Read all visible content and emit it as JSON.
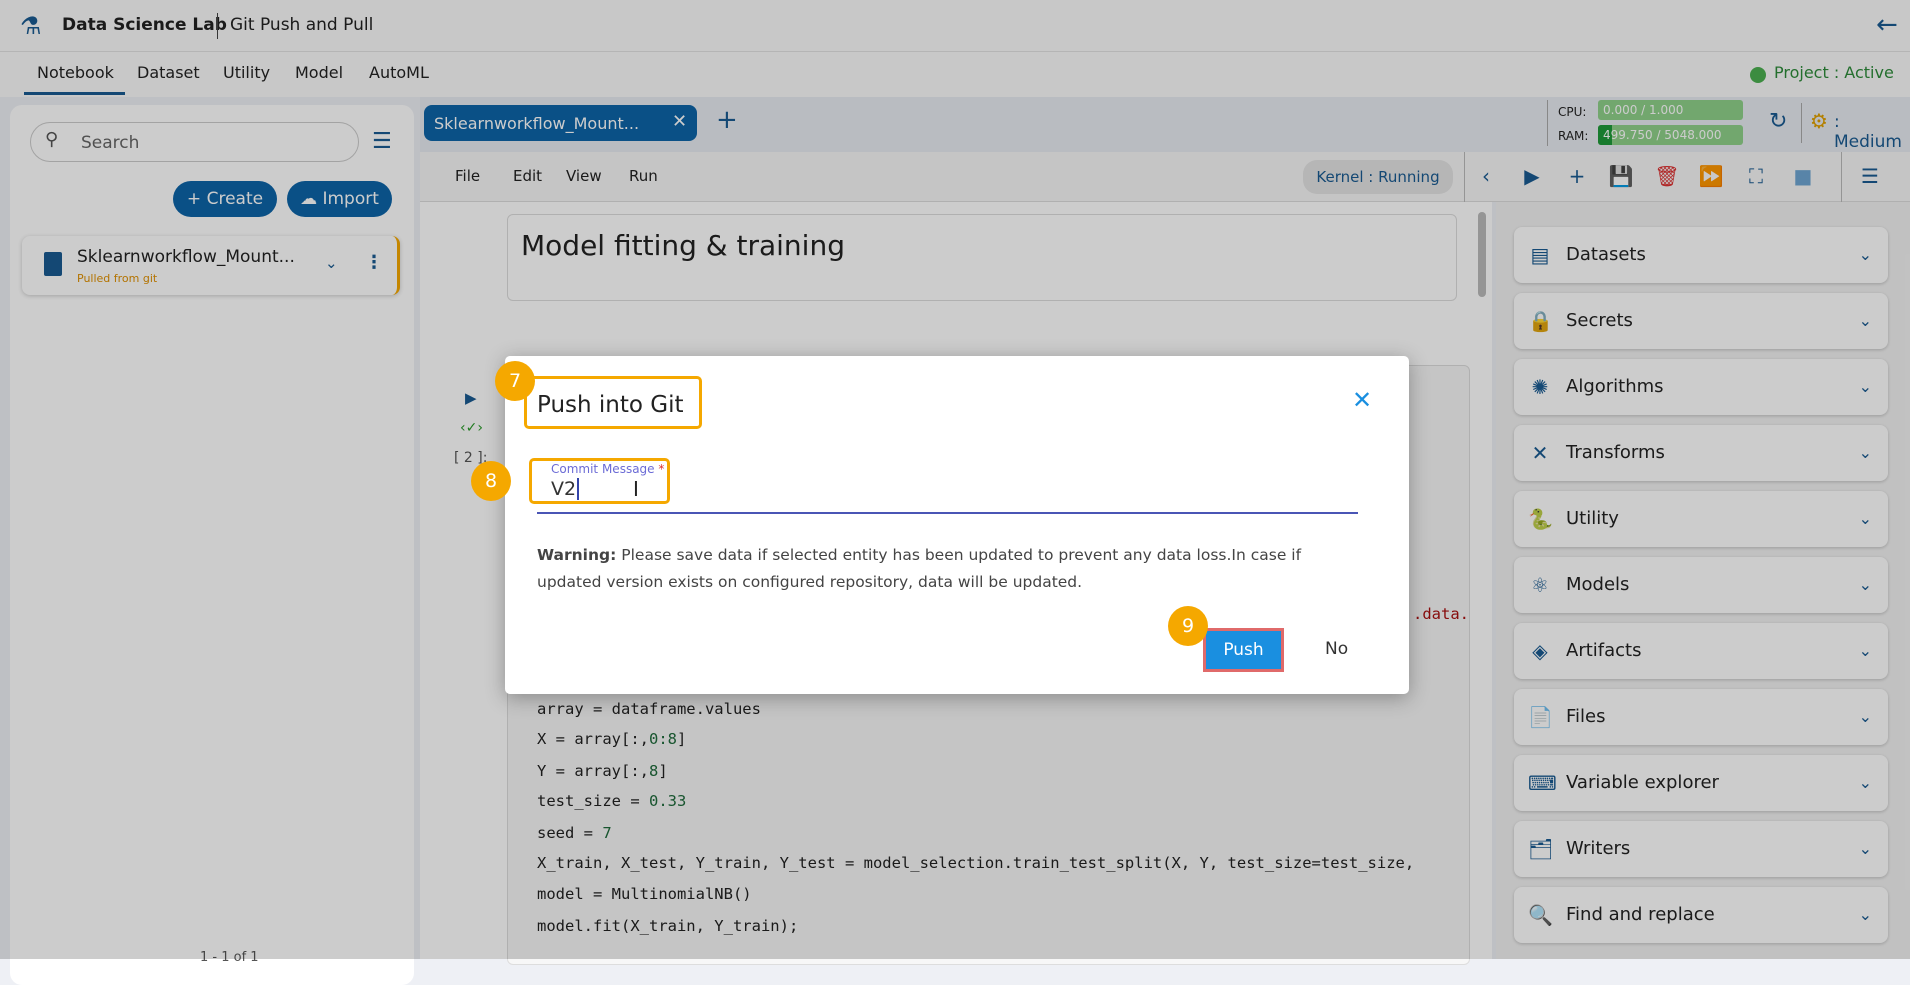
{
  "header": {
    "app_title": "Data Science Lab",
    "page_title": "Git Push and Pull",
    "back_icon": "arrow-left-icon"
  },
  "nav": {
    "tabs": [
      "Notebook",
      "Dataset",
      "Utility",
      "Model",
      "AutoML"
    ],
    "active": "Notebook",
    "project_status": "Project : Active"
  },
  "sidebar": {
    "search_placeholder": "Search",
    "create_label": "Create",
    "import_label": "Import",
    "items": [
      {
        "name": "Sklearnworkflow_Mount...",
        "subtitle": "Pulled from git"
      }
    ],
    "pagination": "1 - 1 of 1"
  },
  "notebook_tab": {
    "label": "Sklearnworkflow_Mount..."
  },
  "resources": {
    "cpu_label": "CPU:",
    "cpu_value": "0.000 / 1.000",
    "cpu_fraction": 0.0,
    "ram_label": "RAM:",
    "ram_value": "499.750 / 5048.000",
    "ram_fraction": 0.099,
    "size": ": Medium"
  },
  "menu": [
    "File",
    "Edit",
    "View",
    "Run"
  ],
  "kernel_status": "Kernel : Running",
  "cells": {
    "markdown": "Model fitting & training",
    "exec_count": "[ 2 ]:",
    "partial_code": ".data.",
    "code_lines": [
      [
        "array = dataframe.values"
      ],
      [
        "X = array[:,",
        "0:8",
        "]"
      ],
      [
        "Y = array[:,",
        "8",
        "]"
      ],
      [
        "test_size = ",
        "0.33",
        ""
      ],
      [
        "seed = ",
        "7",
        ""
      ],
      [
        "X_train, X_test, Y_train, Y_test = model_selection.train_test_split(X, Y, test_size=test_size,"
      ],
      [
        "model = MultinomialNB()"
      ],
      [
        "model.fit(X_train, Y_train);"
      ]
    ]
  },
  "right_panel": [
    "Datasets",
    "Secrets",
    "Algorithms",
    "Transforms",
    "Utility",
    "Models",
    "Artifacts",
    "Files",
    "Variable explorer",
    "Writers",
    "Find and replace"
  ],
  "modal": {
    "title": "Push into Git",
    "field_label": "Commit Message",
    "required_mark": "*",
    "field_value": "V2",
    "warning_bold": "Warning:",
    "warning_text": " Please save data if selected entity has been updated to prevent any data loss.In case if updated version exists on configured repository, data will be updated.",
    "push_label": "Push",
    "no_label": "No"
  },
  "annotations": [
    "7",
    "8",
    "9"
  ],
  "colors": {
    "primary": "#0d64a8",
    "accent": "#f5a800",
    "push": "#1a8fe0",
    "active_green": "#4caf50"
  }
}
